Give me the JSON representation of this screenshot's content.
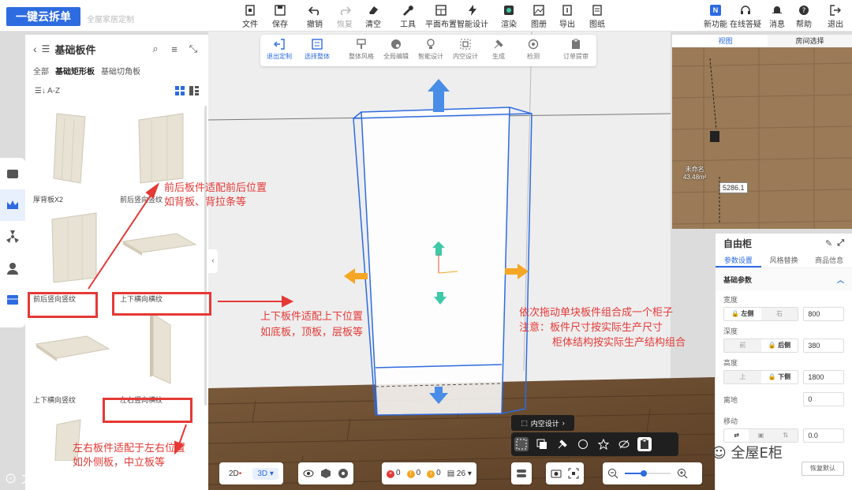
{
  "app": {
    "logo": "一键云拆单",
    "subtitle": "全屋家居定制"
  },
  "toolbar": {
    "file": "文件",
    "save": "保存",
    "undo": "撤销",
    "redo": "恢复",
    "clear": "清空",
    "tools": "工具",
    "plan_layout": "平面布置",
    "smart_design": "智能设计",
    "render": "渲染",
    "drawing": "图册",
    "export": "导出",
    "drawing2": "图纸",
    "new_features": "新功能",
    "online_help": "在线答疑",
    "messages": "消息",
    "help": "帮助",
    "logout": "退出"
  },
  "subtoolbar": {
    "exit_custom": "退出定制",
    "select_whole": "选择整体",
    "overall_style": "整体风格",
    "global_edit": "全局编辑",
    "smart_design": "智能设计",
    "inner_design": "内空设计",
    "generate": "生成",
    "check": "检测",
    "order_submit": "订单提审"
  },
  "left_panel": {
    "title": "基础板件",
    "categories": [
      "全部",
      "基础矩形板",
      "基础切角板"
    ],
    "active_category": "基础矩形板",
    "sort_label": "A-Z",
    "items": [
      {
        "label": "厚背板X2"
      },
      {
        "label": "前后竖向竖纹"
      },
      {
        "label": "前后竖向竖纹"
      },
      {
        "label": "上下横向横纹"
      },
      {
        "label": "上下横向竖纹"
      },
      {
        "label": "左右竖向横纹"
      }
    ]
  },
  "viewport": {
    "tabs": [
      "视图",
      "房间选择"
    ],
    "room_name": "未命名",
    "room_area": "43.48m²",
    "measure": "5286.1"
  },
  "properties": {
    "title": "自由柜",
    "tabs": [
      "参数设置",
      "风格替换",
      "商品信息"
    ],
    "section": "基础参数",
    "width": {
      "label": "宽度",
      "opt_a": "左侧",
      "opt_b": "右",
      "value": "800"
    },
    "depth": {
      "label": "深度",
      "opt_a": "前",
      "opt_b": "后侧",
      "value": "380"
    },
    "height": {
      "label": "高度",
      "opt_a": "上",
      "opt_b": "下侧",
      "value": "1800"
    },
    "ground": {
      "label": "离地",
      "value": "0"
    },
    "move": {
      "label": "移动",
      "value": "0.0"
    },
    "restore": "恢复默认"
  },
  "bottom": {
    "mode_2d": "2D",
    "mode_3d": "3D",
    "err_count": "0",
    "warn_count": "0",
    "info_count": "0",
    "panel_count": "26"
  },
  "float": {
    "inner_design": "内空设计"
  },
  "annotations": {
    "front_back_1": "前后板件适配前后位置",
    "front_back_2": "如背板、背拉条等",
    "top_bottom_1": "上下板件适配上下位置",
    "top_bottom_2": "如底板，顶板，层板等",
    "left_right_1": "左右板件适配于左右位置",
    "left_right_2": "如外侧板，中立板等",
    "combine_1": "依次拖动单块板件组合成一个柜子",
    "combine_2": "注意：板件尺寸按实际生产尺寸",
    "combine_3": "柜体结构按实际生产结构组合"
  },
  "watermarks": {
    "left": "大数跨境",
    "right": "全屋E柜"
  },
  "colors": {
    "accent": "#2d6be0",
    "annotation": "#e53935",
    "arrow_blue": "#4a8de6",
    "arrow_orange": "#f5a623",
    "arrow_green": "#3ec9a7"
  }
}
